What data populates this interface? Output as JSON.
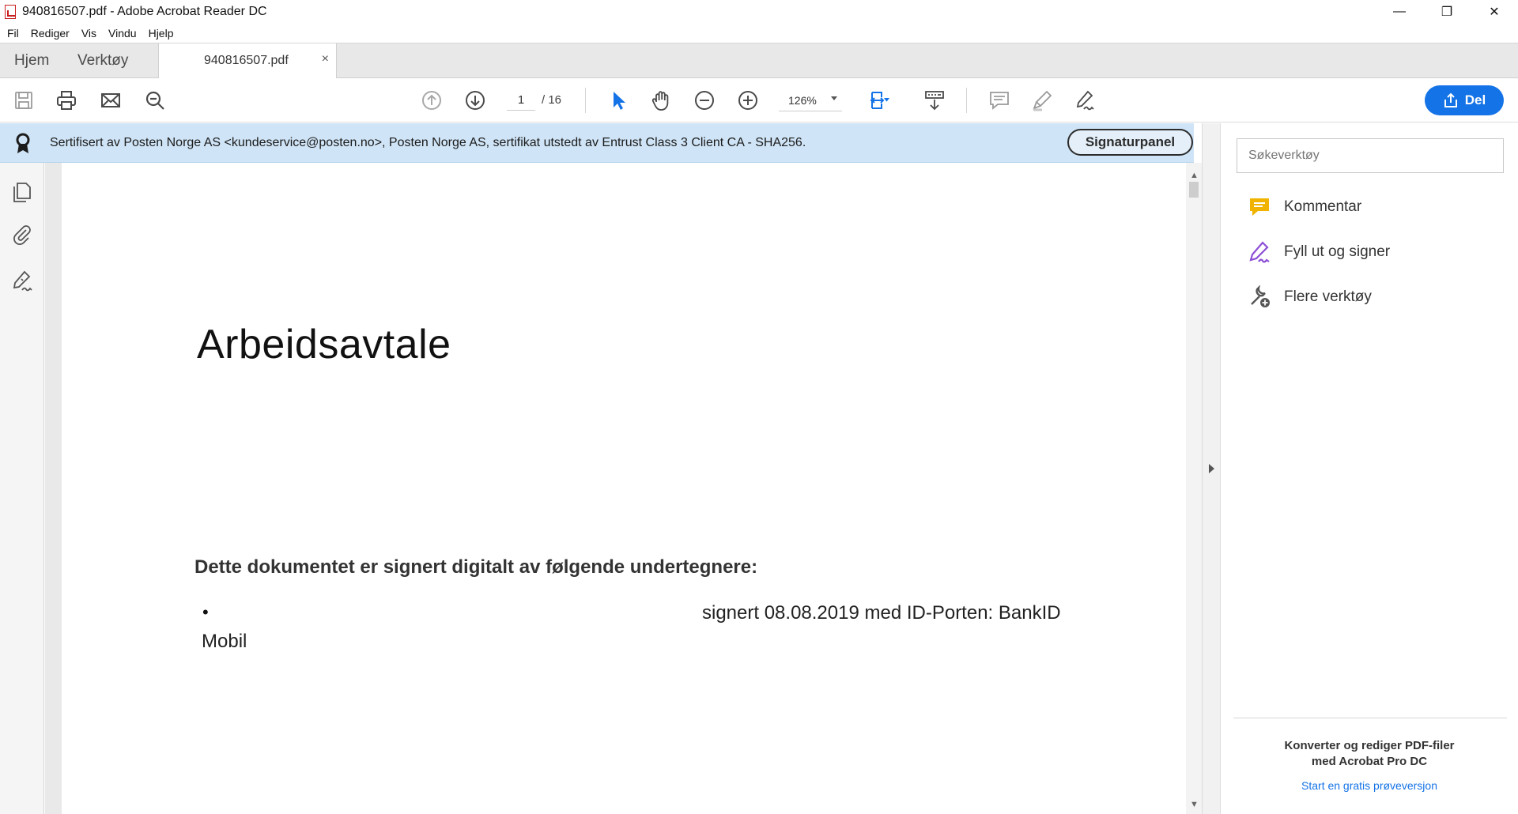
{
  "window": {
    "title": "940816507.pdf - Adobe Acrobat Reader DC",
    "controls": {
      "minimize": "—",
      "restore": "❐",
      "close": "✕"
    }
  },
  "menu": [
    "Fil",
    "Rediger",
    "Vis",
    "Vindu",
    "Hjelp"
  ],
  "tabs": {
    "home": "Hjem",
    "tools": "Verktøy",
    "document": "940816507.pdf",
    "close": "×"
  },
  "toolbar": {
    "page_current": "1",
    "page_total": "/ 16",
    "zoom": "126%",
    "share_label": "Del"
  },
  "signature_bar": {
    "text": "Sertifisert av Posten Norge AS <kundeservice@posten.no>, Posten Norge AS, sertifikat utstedt av Entrust Class 3 Client CA - SHA256.",
    "button": "Signaturpanel"
  },
  "document": {
    "title": "Arbeidsavtale",
    "intro": "Dette dokumentet er signert digitalt av følgende undertegnere:",
    "bullet": "•",
    "signer_line": "signert 08.08.2019 med ID-Porten: BankID",
    "signer_line_cont": "Mobil"
  },
  "right_pane": {
    "search_placeholder": "Søkeverktøy",
    "tools": [
      "Kommentar",
      "Fyll ut og signer",
      "Flere verktøy"
    ],
    "promo_line1": "Konverter og rediger PDF-filer",
    "promo_line2": "med Acrobat Pro DC",
    "promo_link": "Start en gratis prøveversjon"
  },
  "colors": {
    "accent": "#1473e6",
    "signature_bar": "#cfe4f6",
    "comment_icon": "#f0b400",
    "sign_icon": "#8c4fd6"
  }
}
